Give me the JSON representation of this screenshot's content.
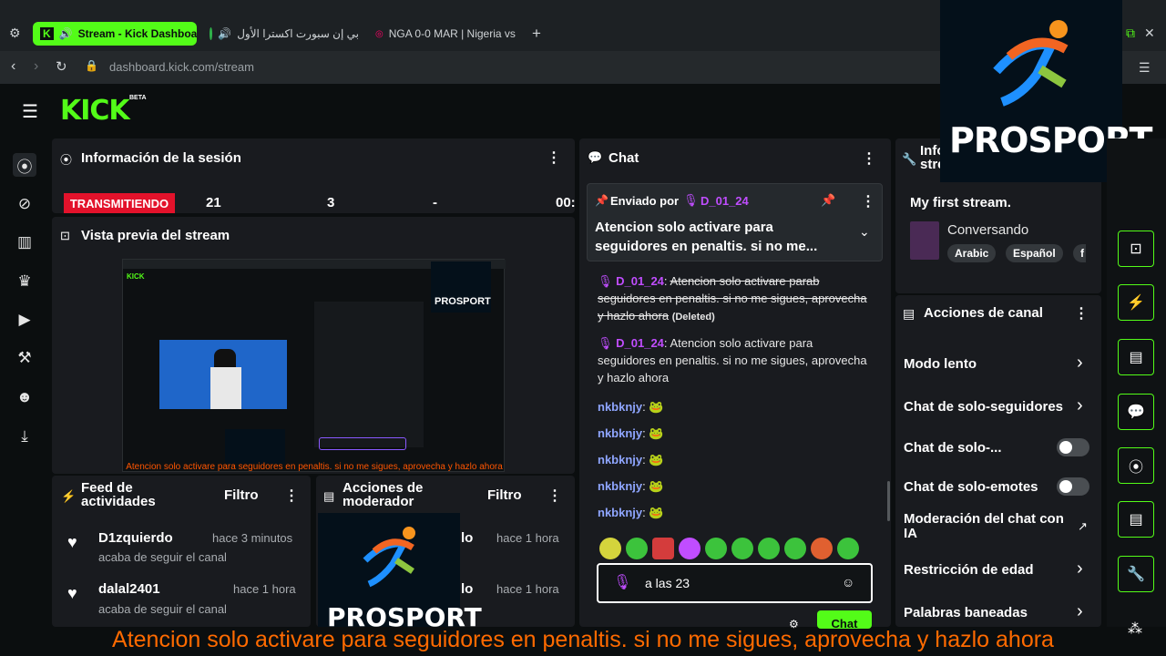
{
  "browser": {
    "tabs": [
      {
        "label": "Stream - Kick Dashboa"
      },
      {
        "label": "بي إن سبورت اكسترا الأول"
      },
      {
        "label": "NGA 0-0 MAR | Nigeria vs"
      }
    ],
    "url": "dashboard.kick.com/stream"
  },
  "brand": {
    "logo": "KICK",
    "beta": "BETA",
    "accent": "#53fc18"
  },
  "session": {
    "title": "Información de la sesión",
    "status": "TRANSMITIENDO",
    "stats": [
      "21",
      "3",
      "-",
      "00:"
    ]
  },
  "preview": {
    "title": "Vista previa del stream",
    "subtitle_caption": "Atencion solo activare para seguidores en penaltis. si no me sigues, aprovecha y hazlo ahora"
  },
  "activity": {
    "title": "Feed de actividades",
    "filter": "Filtro",
    "items": [
      {
        "user": "D1zquierdo",
        "time": "hace 3 minutos",
        "action": "acaba de seguir el canal"
      },
      {
        "user": "dalal2401",
        "time": "hace 1 hora",
        "action": "acaba de seguir el canal"
      }
    ]
  },
  "moderator": {
    "title": "Acciones de moderador",
    "filter": "Filtro",
    "items": [
      {
        "user": "lo",
        "time": "hace 1 hora"
      },
      {
        "user": "lo",
        "time": "hace 1 hora"
      }
    ]
  },
  "chat": {
    "title": "Chat",
    "pinned_by_label": "Enviado por",
    "pinned_user": "D_01_24",
    "pinned_text": "Atencion solo activare para seguidores en penaltis. si no me...",
    "messages": [
      {
        "user": "D_01_24",
        "text": "Atencion solo activare parab seguidores en penaltis. si no me sigues, aprovecha y hazlo ahora",
        "deleted": "(Deleted)"
      },
      {
        "user": "D_01_24",
        "text": "Atencion solo activare para seguidores en penaltis. si no me sigues, aprovecha y hazlo ahora"
      },
      {
        "user": "nkbknjy"
      },
      {
        "user": "nkbknjy"
      },
      {
        "user": "nkbknjy"
      },
      {
        "user": "nkbknjy"
      },
      {
        "user": "nkbknjy"
      }
    ],
    "input_value": "a las 23",
    "send_label": "Chat"
  },
  "stream_info": {
    "title": "Info stre",
    "stream_title": "My first stream.",
    "category": "Conversando",
    "tags": [
      "Arabic",
      "Español",
      "f"
    ]
  },
  "channel_actions": {
    "title": "Acciones de canal",
    "rows": [
      {
        "label": "Modo lento",
        "control": "chevron"
      },
      {
        "label": "Chat de solo-seguidores",
        "control": "chevron"
      },
      {
        "label": "Chat de solo-...",
        "control": "toggle"
      },
      {
        "label": "Chat de solo-emotes",
        "control": "toggle"
      },
      {
        "label": "Moderación del chat con IA",
        "control": "external"
      },
      {
        "label": "Restricción de edad",
        "control": "chevron"
      },
      {
        "label": "Palabras baneadas",
        "control": "chevron"
      }
    ]
  },
  "overlay": {
    "watermark": "PROSPORT"
  },
  "caption": "Atencion solo activare para seguidores en penaltis. si no me sigues, aprovecha y hazlo ahora",
  "colors": {
    "live": "#e3122b",
    "purple_user": "#c04dff",
    "blue_user": "#8fa6ff",
    "caption": "#ff6a00"
  }
}
